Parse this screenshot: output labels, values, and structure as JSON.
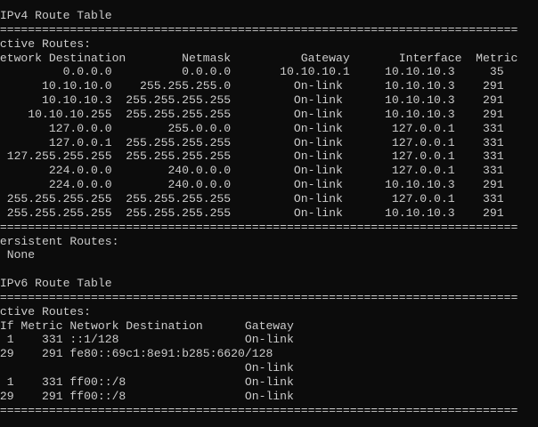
{
  "console": {
    "lines": [
      " IPv4 Route Table",
      "===========================================================================",
      "Active Routes:",
      "Network Destination        Netmask          Gateway       Interface  Metric",
      "          0.0.0.0          0.0.0.0       10.10.10.1     10.10.10.3     35",
      "       10.10.10.0    255.255.255.0         On-link      10.10.10.3    291",
      "       10.10.10.3  255.255.255.255         On-link      10.10.10.3    291",
      "     10.10.10.255  255.255.255.255         On-link      10.10.10.3    291",
      "        127.0.0.0        255.0.0.0         On-link       127.0.0.1    331",
      "        127.0.0.1  255.255.255.255         On-link       127.0.0.1    331",
      "  127.255.255.255  255.255.255.255         On-link       127.0.0.1    331",
      "        224.0.0.0        240.0.0.0         On-link       127.0.0.1    331",
      "        224.0.0.0        240.0.0.0         On-link      10.10.10.3    291",
      "  255.255.255.255  255.255.255.255         On-link       127.0.0.1    331",
      "  255.255.255.255  255.255.255.255         On-link      10.10.10.3    291",
      "===========================================================================",
      "Persistent Routes:",
      "  None",
      "",
      " IPv6 Route Table",
      "===========================================================================",
      "Active Routes:",
      " If Metric Network Destination      Gateway",
      "  1    331 ::1/128                  On-link",
      " 29    291 fe80::69c1:8e91:b285:6620/128",
      "                                    On-link",
      "  1    331 ff00::/8                 On-link",
      " 29    291 ff00::/8                 On-link",
      "==========================================================================="
    ]
  }
}
